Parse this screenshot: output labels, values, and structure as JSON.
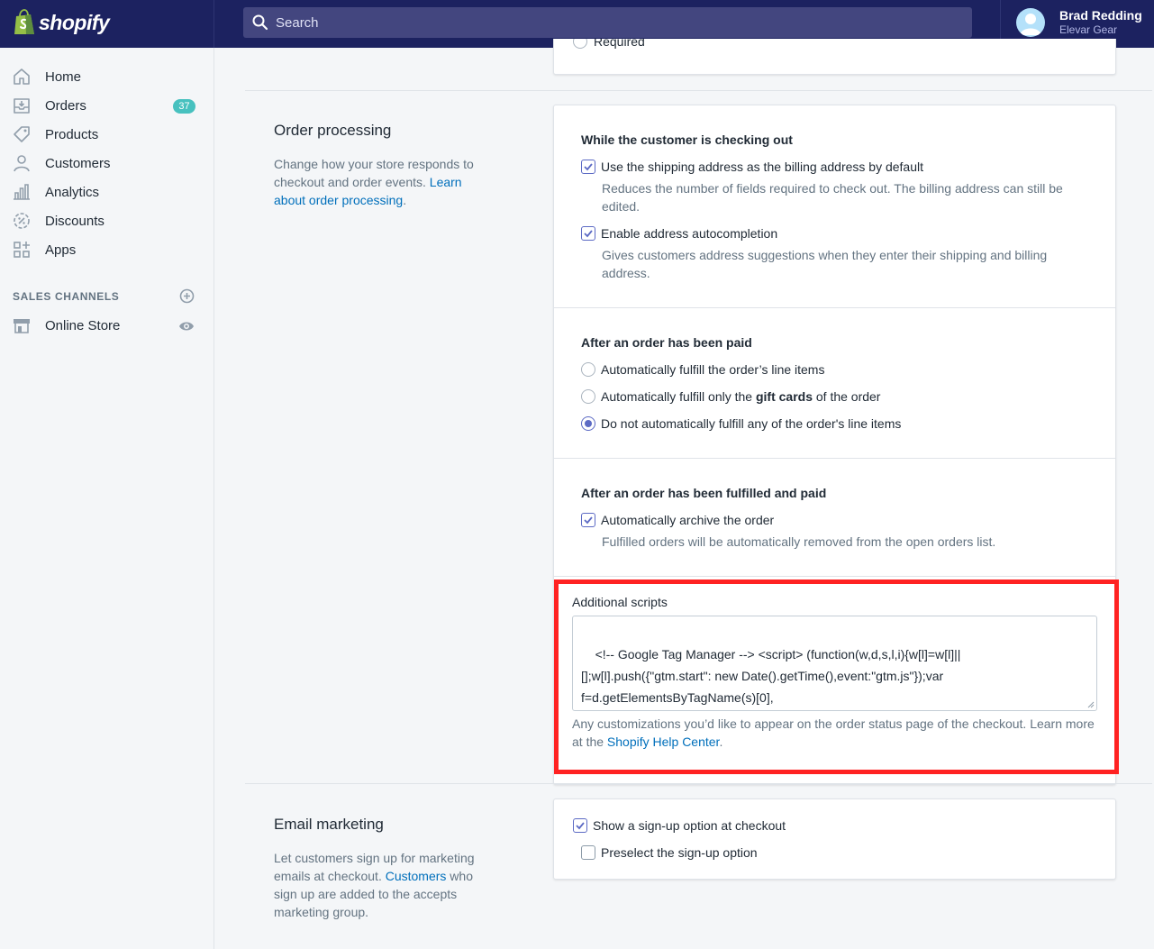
{
  "topbar": {
    "brand": "shopify",
    "search_placeholder": "Search",
    "user_name": "Brad Redding",
    "store_name": "Elevar Gear"
  },
  "sidebar": {
    "items": [
      {
        "label": "Home",
        "icon": "home-icon"
      },
      {
        "label": "Orders",
        "icon": "orders-icon",
        "badge": "37"
      },
      {
        "label": "Products",
        "icon": "tag-icon"
      },
      {
        "label": "Customers",
        "icon": "person-icon"
      },
      {
        "label": "Analytics",
        "icon": "bar-chart-icon"
      },
      {
        "label": "Discounts",
        "icon": "discount-icon"
      },
      {
        "label": "Apps",
        "icon": "apps-icon"
      }
    ],
    "sales_channels_title": "SALES CHANNELS",
    "online_store": "Online Store"
  },
  "top_fragment": {
    "label": "Required"
  },
  "order_processing": {
    "title": "Order processing",
    "desc_prefix": "Change how your store responds to checkout and order events. ",
    "desc_link": "Learn about order processing",
    "desc_suffix": ".",
    "checkout": {
      "heading": "While the customer is checking out",
      "opt1_label": "Use the shipping address as the billing address by default",
      "opt1_help": "Reduces the number of fields required to check out. The billing address can still be edited.",
      "opt2_label": "Enable address autocompletion",
      "opt2_help": "Gives customers address suggestions when they enter their shipping and billing address."
    },
    "paid": {
      "heading": "After an order has been paid",
      "r1": "Automatically fulfill the order’s line items",
      "r2_prefix": "Automatically fulfill only the ",
      "r2_bold": "gift cards",
      "r2_suffix": " of the order",
      "r3": "Do not automatically fulfill any of the order's line items"
    },
    "fulfilled": {
      "heading": "After an order has been fulfilled and paid",
      "opt_label": "Automatically archive the order",
      "opt_help": "Fulfilled orders will be automatically removed from the open orders list."
    },
    "scripts": {
      "label": "Additional scripts",
      "value": "<!-- Google Tag Manager --> <script> (function(w,d,s,l,i){w[l]=w[l]||\n[];w[l].push({\"gtm.start\": new Date().getTime(),event:\"gtm.js\"});var\nf=d.getElementsByTagName(s)[0],\nj=d.createElement(s),dl=l!=\"dataLayer\"?\"&l=\"+l:\"\";j.async=true;j.src=",
      "help_prefix": "Any customizations you’d like to appear on the order status page of the checkout. Learn more at the ",
      "help_link": "Shopify Help Center",
      "help_suffix": "."
    }
  },
  "email_marketing": {
    "title": "Email marketing",
    "desc_prefix": "Let customers sign up for marketing emails at checkout. ",
    "desc_link": "Customers",
    "desc_suffix": " who sign up are added to the accepts marketing group.",
    "opt1": "Show a sign-up option at checkout",
    "opt2": "Preselect the sign-up option"
  },
  "colors": {
    "topbar": "#1c2260",
    "accent": "#5c6ac4",
    "link": "#006fbb",
    "highlight": "#ff2222",
    "badge": "#47c1bf"
  }
}
